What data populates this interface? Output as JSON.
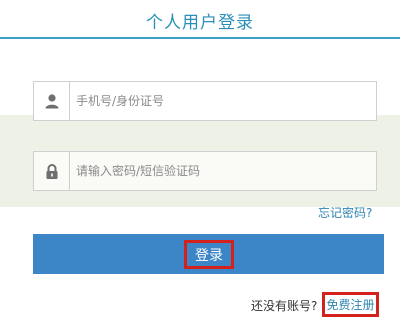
{
  "page": {
    "title": "个人用户登录"
  },
  "form": {
    "username": {
      "placeholder": "手机号/身份证号",
      "value": "",
      "icon": "user-icon"
    },
    "password": {
      "placeholder": "请输入密码/短信验证码",
      "value": "",
      "icon": "lock-icon"
    },
    "forgot_label": "忘记密码?",
    "login_label": "登录"
  },
  "footer": {
    "no_account_label": "还没有账号?",
    "register_label": "免费注册"
  },
  "colors": {
    "accent": "#3c86c8",
    "title_color": "#2a8fb8",
    "highlight": "#d5211c",
    "link": "#2f86b3"
  }
}
